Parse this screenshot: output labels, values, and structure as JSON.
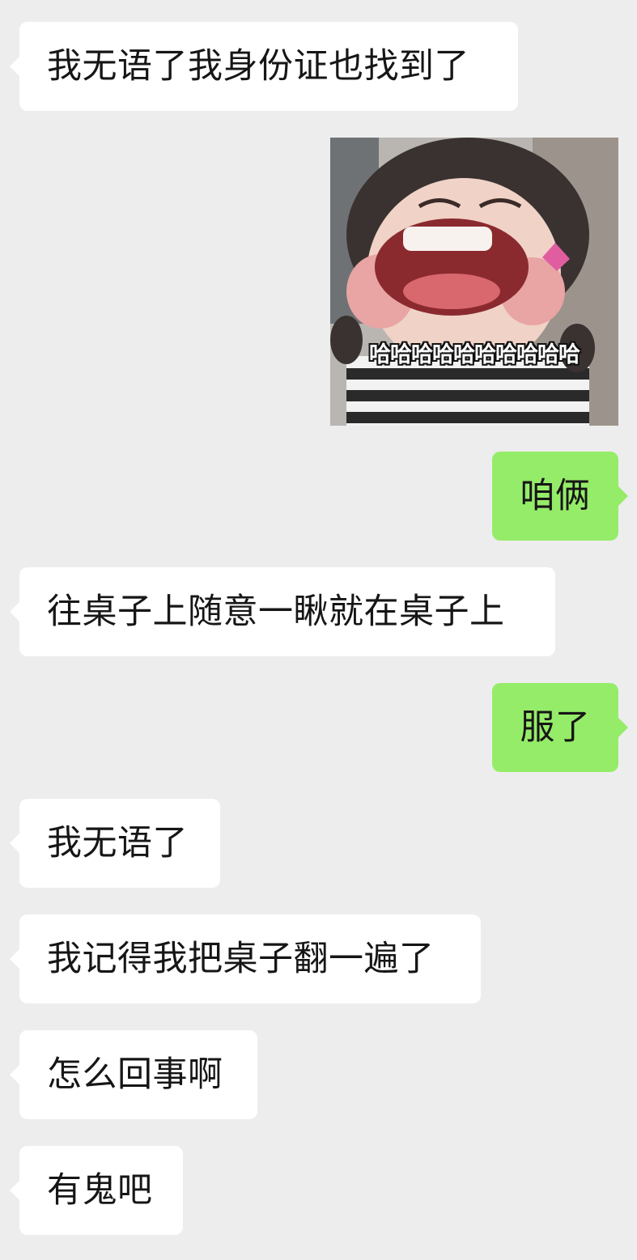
{
  "messages": [
    {
      "text": "我无语了我身份证也找到了"
    },
    {
      "sticker_caption": "哈哈哈哈哈哈哈哈哈哈"
    },
    {
      "text": "咱俩"
    },
    {
      "text": "往桌子上随意一瞅就在桌子上"
    },
    {
      "text": "服了"
    },
    {
      "text": "我无语了"
    },
    {
      "text": "我记得我把桌子翻一遍了"
    },
    {
      "text": "怎么回事啊"
    },
    {
      "text": "有鬼吧"
    }
  ],
  "colors": {
    "background": "#ededed",
    "incoming_bubble": "#ffffff",
    "outgoing_bubble": "#95ec69"
  }
}
